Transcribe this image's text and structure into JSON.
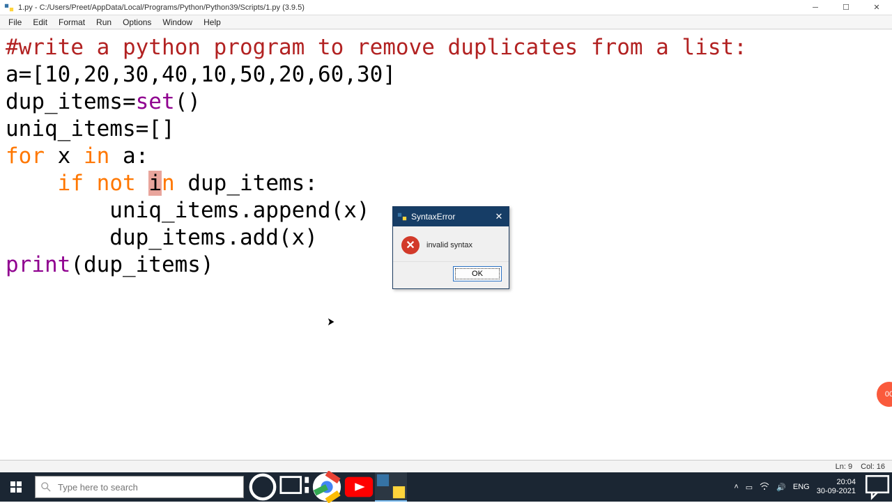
{
  "window": {
    "title": "1.py - C:/Users/Preet/AppData/Local/Programs/Python/Python39/Scripts/1.py (3.9.5)"
  },
  "menu": {
    "items": [
      "File",
      "Edit",
      "Format",
      "Run",
      "Options",
      "Window",
      "Help"
    ]
  },
  "code": {
    "line1_comment": "#write a python program to remove duplicates from a list:",
    "line2_a": "a=[",
    "line2_b": "10",
    "line2_c": ",",
    "line2_d": "20",
    "line2_e": ",",
    "line2_f": "30",
    "line2_g": ",",
    "line2_h": "40",
    "line2_i": ",",
    "line2_j": "10",
    "line2_k": ",",
    "line2_l": "50",
    "line2_m": ",",
    "line2_n": "20",
    "line2_o": ",",
    "line2_p": "60",
    "line2_q": ",",
    "line2_r": "30",
    "line2_s": "]",
    "line3_a": "dup_items=",
    "line3_b": "set",
    "line3_c": "()",
    "line4": "uniq_items=[]",
    "line5_a": "for",
    "line5_b": " x ",
    "line5_c": "in",
    "line5_d": " a:",
    "line6_a": "    ",
    "line6_b": "if",
    "line6_c": " ",
    "line6_d": "not",
    "line6_e": " ",
    "line6_err": "i",
    "line6_f": "n",
    "line6_g": " dup_items:",
    "line7": "        uniq_items.append(x)",
    "line8": "        dup_items.add(x)",
    "line9_a": "print",
    "line9_b": "(dup_items)"
  },
  "status": {
    "ln_label": "Ln:",
    "ln": "9",
    "col_label": "Col:",
    "col": "16"
  },
  "dialog": {
    "title": "SyntaxError",
    "message": "invalid syntax",
    "ok": "OK"
  },
  "taskbar": {
    "search_placeholder": "Type here to search",
    "lang": "ENG",
    "time": "20:04",
    "date": "30-09-2021"
  },
  "recorder": {
    "label": "00"
  }
}
